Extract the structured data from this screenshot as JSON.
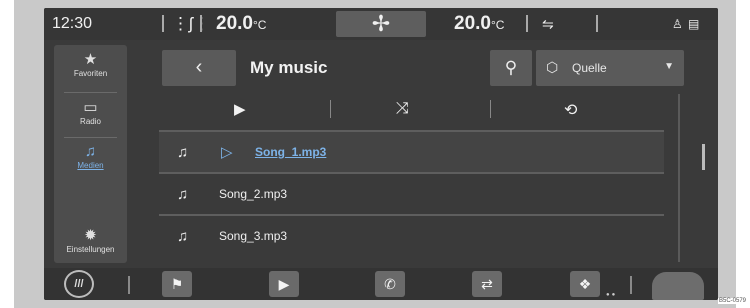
{
  "status_bar": {
    "time": "12:30",
    "temp_left": "20.0",
    "temp_right": "20.0",
    "temp_unit": "°C",
    "seat_icon": "seat-heat-icon",
    "fan_icon": "fan-icon",
    "recirc_icon": "air-recirculation-icon",
    "profile_icon": "user-profile-icon",
    "phone_icon": "phone-status-icon"
  },
  "sidebar": {
    "items": [
      {
        "label": "Favoriten",
        "icon": "star-icon"
      },
      {
        "label": "Radio",
        "icon": "radio-icon"
      },
      {
        "label": "Medien",
        "icon": "media-icon",
        "active": true
      },
      {
        "label": "Einstellungen",
        "icon": "gear-icon"
      }
    ]
  },
  "header": {
    "title": "My music",
    "back_icon": "chevron-left-icon",
    "search_icon": "search-icon",
    "source_label": "Quelle",
    "source_icon": "cube-icon"
  },
  "controls": {
    "play_icon": "play-icon",
    "shuffle_icon": "shuffle-icon",
    "repeat_icon": "repeat-icon"
  },
  "tracks": [
    {
      "name": "Song_1.mp3",
      "playing": true
    },
    {
      "name": "Song_2.mp3",
      "playing": false
    },
    {
      "name": "Song_3.mp3",
      "playing": false
    }
  ],
  "dock": {
    "items": [
      "menu-icon",
      "flag-icon",
      "play-icon",
      "phone-icon",
      "phone-connect-icon",
      "app-icon",
      "car-icon"
    ]
  },
  "image_code": "B5C-0579",
  "colors": {
    "accent": "#7db3e8",
    "background": "#3a3a3a"
  }
}
